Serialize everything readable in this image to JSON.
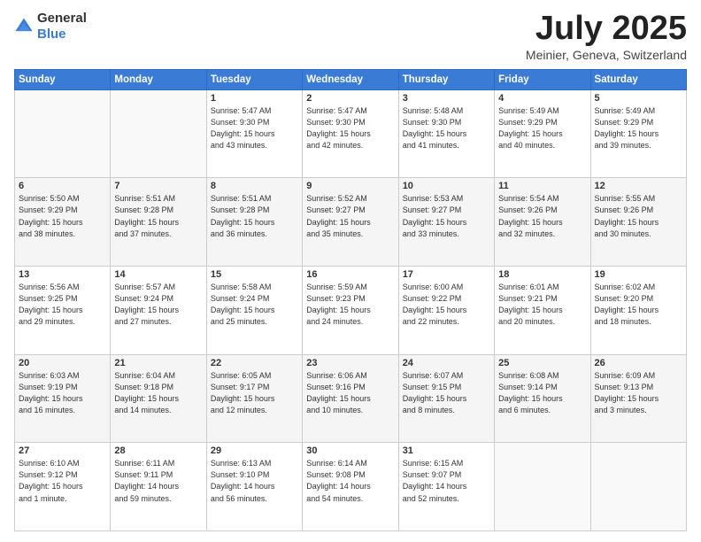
{
  "header": {
    "logo": {
      "general": "General",
      "blue": "Blue"
    },
    "title": "July 2025",
    "subtitle": "Meinier, Geneva, Switzerland"
  },
  "days_of_week": [
    "Sunday",
    "Monday",
    "Tuesday",
    "Wednesday",
    "Thursday",
    "Friday",
    "Saturday"
  ],
  "weeks": [
    [
      {
        "day": "",
        "detail": ""
      },
      {
        "day": "",
        "detail": ""
      },
      {
        "day": "1",
        "detail": "Sunrise: 5:47 AM\nSunset: 9:30 PM\nDaylight: 15 hours\nand 43 minutes."
      },
      {
        "day": "2",
        "detail": "Sunrise: 5:47 AM\nSunset: 9:30 PM\nDaylight: 15 hours\nand 42 minutes."
      },
      {
        "day": "3",
        "detail": "Sunrise: 5:48 AM\nSunset: 9:30 PM\nDaylight: 15 hours\nand 41 minutes."
      },
      {
        "day": "4",
        "detail": "Sunrise: 5:49 AM\nSunset: 9:29 PM\nDaylight: 15 hours\nand 40 minutes."
      },
      {
        "day": "5",
        "detail": "Sunrise: 5:49 AM\nSunset: 9:29 PM\nDaylight: 15 hours\nand 39 minutes."
      }
    ],
    [
      {
        "day": "6",
        "detail": "Sunrise: 5:50 AM\nSunset: 9:29 PM\nDaylight: 15 hours\nand 38 minutes."
      },
      {
        "day": "7",
        "detail": "Sunrise: 5:51 AM\nSunset: 9:28 PM\nDaylight: 15 hours\nand 37 minutes."
      },
      {
        "day": "8",
        "detail": "Sunrise: 5:51 AM\nSunset: 9:28 PM\nDaylight: 15 hours\nand 36 minutes."
      },
      {
        "day": "9",
        "detail": "Sunrise: 5:52 AM\nSunset: 9:27 PM\nDaylight: 15 hours\nand 35 minutes."
      },
      {
        "day": "10",
        "detail": "Sunrise: 5:53 AM\nSunset: 9:27 PM\nDaylight: 15 hours\nand 33 minutes."
      },
      {
        "day": "11",
        "detail": "Sunrise: 5:54 AM\nSunset: 9:26 PM\nDaylight: 15 hours\nand 32 minutes."
      },
      {
        "day": "12",
        "detail": "Sunrise: 5:55 AM\nSunset: 9:26 PM\nDaylight: 15 hours\nand 30 minutes."
      }
    ],
    [
      {
        "day": "13",
        "detail": "Sunrise: 5:56 AM\nSunset: 9:25 PM\nDaylight: 15 hours\nand 29 minutes."
      },
      {
        "day": "14",
        "detail": "Sunrise: 5:57 AM\nSunset: 9:24 PM\nDaylight: 15 hours\nand 27 minutes."
      },
      {
        "day": "15",
        "detail": "Sunrise: 5:58 AM\nSunset: 9:24 PM\nDaylight: 15 hours\nand 25 minutes."
      },
      {
        "day": "16",
        "detail": "Sunrise: 5:59 AM\nSunset: 9:23 PM\nDaylight: 15 hours\nand 24 minutes."
      },
      {
        "day": "17",
        "detail": "Sunrise: 6:00 AM\nSunset: 9:22 PM\nDaylight: 15 hours\nand 22 minutes."
      },
      {
        "day": "18",
        "detail": "Sunrise: 6:01 AM\nSunset: 9:21 PM\nDaylight: 15 hours\nand 20 minutes."
      },
      {
        "day": "19",
        "detail": "Sunrise: 6:02 AM\nSunset: 9:20 PM\nDaylight: 15 hours\nand 18 minutes."
      }
    ],
    [
      {
        "day": "20",
        "detail": "Sunrise: 6:03 AM\nSunset: 9:19 PM\nDaylight: 15 hours\nand 16 minutes."
      },
      {
        "day": "21",
        "detail": "Sunrise: 6:04 AM\nSunset: 9:18 PM\nDaylight: 15 hours\nand 14 minutes."
      },
      {
        "day": "22",
        "detail": "Sunrise: 6:05 AM\nSunset: 9:17 PM\nDaylight: 15 hours\nand 12 minutes."
      },
      {
        "day": "23",
        "detail": "Sunrise: 6:06 AM\nSunset: 9:16 PM\nDaylight: 15 hours\nand 10 minutes."
      },
      {
        "day": "24",
        "detail": "Sunrise: 6:07 AM\nSunset: 9:15 PM\nDaylight: 15 hours\nand 8 minutes."
      },
      {
        "day": "25",
        "detail": "Sunrise: 6:08 AM\nSunset: 9:14 PM\nDaylight: 15 hours\nand 6 minutes."
      },
      {
        "day": "26",
        "detail": "Sunrise: 6:09 AM\nSunset: 9:13 PM\nDaylight: 15 hours\nand 3 minutes."
      }
    ],
    [
      {
        "day": "27",
        "detail": "Sunrise: 6:10 AM\nSunset: 9:12 PM\nDaylight: 15 hours\nand 1 minute."
      },
      {
        "day": "28",
        "detail": "Sunrise: 6:11 AM\nSunset: 9:11 PM\nDaylight: 14 hours\nand 59 minutes."
      },
      {
        "day": "29",
        "detail": "Sunrise: 6:13 AM\nSunset: 9:10 PM\nDaylight: 14 hours\nand 56 minutes."
      },
      {
        "day": "30",
        "detail": "Sunrise: 6:14 AM\nSunset: 9:08 PM\nDaylight: 14 hours\nand 54 minutes."
      },
      {
        "day": "31",
        "detail": "Sunrise: 6:15 AM\nSunset: 9:07 PM\nDaylight: 14 hours\nand 52 minutes."
      },
      {
        "day": "",
        "detail": ""
      },
      {
        "day": "",
        "detail": ""
      }
    ]
  ]
}
